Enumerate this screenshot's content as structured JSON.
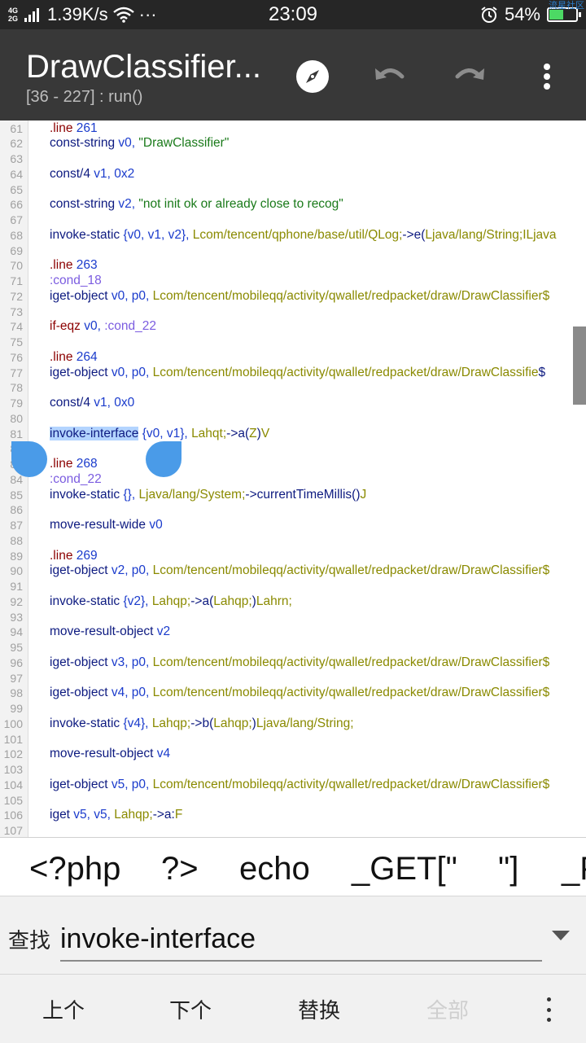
{
  "status_bar": {
    "network_top": "4G",
    "network_bottom": "2G",
    "speed": "1.39K/s",
    "more": "···",
    "time": "23:09",
    "battery_percent": "54%",
    "battery_level": 0.54,
    "watermark": "流星社区"
  },
  "app_bar": {
    "title": "DrawClassifier...",
    "subtitle": "[36 - 227] : run()",
    "icons": [
      "compass-icon",
      "undo-icon",
      "redo-icon",
      "more-vert-icon"
    ]
  },
  "editor": {
    "highlight_text": "invoke-interface",
    "lines": [
      {
        "n": "61",
        "tokens": [
          {
            "t": ".line",
            "c": "dir"
          },
          {
            "t": " 261",
            "c": "num"
          }
        ]
      },
      {
        "n": "62",
        "tokens": [
          {
            "t": "const-string",
            "c": "kw"
          },
          {
            "t": " v0, ",
            "c": "reg"
          },
          {
            "t": "\"DrawClassifier\"",
            "c": "str"
          }
        ]
      },
      {
        "n": "63",
        "tokens": []
      },
      {
        "n": "64",
        "tokens": [
          {
            "t": "const/4",
            "c": "kw"
          },
          {
            "t": " v1, ",
            "c": "reg"
          },
          {
            "t": "0x2",
            "c": "num"
          }
        ]
      },
      {
        "n": "65",
        "tokens": []
      },
      {
        "n": "66",
        "tokens": [
          {
            "t": "const-string",
            "c": "kw"
          },
          {
            "t": " v2, ",
            "c": "reg"
          },
          {
            "t": "\"not init ok or already close to recog\"",
            "c": "str"
          }
        ]
      },
      {
        "n": "67",
        "tokens": []
      },
      {
        "n": "68",
        "tokens": [
          {
            "t": "invoke-static",
            "c": "kw"
          },
          {
            "t": " {v0, v1, v2}, ",
            "c": "reg"
          },
          {
            "t": "Lcom/tencent/qphone/base/util/QLog;",
            "c": "cls"
          },
          {
            "t": "->e(",
            "c": "kw"
          },
          {
            "t": "Ljava/lang/String;ILjava",
            "c": "cls"
          }
        ]
      },
      {
        "n": "69",
        "tokens": []
      },
      {
        "n": "70",
        "tokens": [
          {
            "t": ".line",
            "c": "dir"
          },
          {
            "t": " 263",
            "c": "num"
          }
        ]
      },
      {
        "n": "71",
        "tokens": [
          {
            "t": ":cond_18",
            "c": "lbl"
          }
        ]
      },
      {
        "n": "72",
        "tokens": [
          {
            "t": "iget-object",
            "c": "kw"
          },
          {
            "t": " v0, p0, ",
            "c": "reg"
          },
          {
            "t": "Lcom/tencent/mobileqq/activity/qwallet/redpacket/draw/DrawClassifier$",
            "c": "cls"
          }
        ]
      },
      {
        "n": "73",
        "tokens": []
      },
      {
        "n": "74",
        "tokens": [
          {
            "t": "if-eqz",
            "c": "dir"
          },
          {
            "t": " v0, ",
            "c": "reg"
          },
          {
            "t": ":cond_22",
            "c": "lbl"
          }
        ]
      },
      {
        "n": "75",
        "tokens": []
      },
      {
        "n": "76",
        "tokens": [
          {
            "t": ".line",
            "c": "dir"
          },
          {
            "t": " 264",
            "c": "num"
          }
        ]
      },
      {
        "n": "77",
        "tokens": [
          {
            "t": "iget-object",
            "c": "kw"
          },
          {
            "t": " v0, p0, ",
            "c": "reg"
          },
          {
            "t": "Lcom/tencent/mobileqq/activity/qwallet/redpacket/draw/DrawClassifie",
            "c": "cls"
          },
          {
            "t": "$",
            "c": "kw"
          }
        ]
      },
      {
        "n": "78",
        "tokens": []
      },
      {
        "n": "79",
        "tokens": [
          {
            "t": "const/4",
            "c": "kw"
          },
          {
            "t": " v1, ",
            "c": "reg"
          },
          {
            "t": "0x0",
            "c": "num"
          }
        ]
      },
      {
        "n": "80",
        "tokens": []
      },
      {
        "n": "81",
        "tokens": [
          {
            "t": "invoke-interface",
            "c": "kw hl"
          },
          {
            "t": " {v0, v1}, ",
            "c": "reg"
          },
          {
            "t": "Lahqt;",
            "c": "cls"
          },
          {
            "t": "->a(",
            "c": "kw"
          },
          {
            "t": "Z",
            "c": "cls"
          },
          {
            "t": ")",
            "c": "kw"
          },
          {
            "t": "V",
            "c": "cls"
          }
        ]
      },
      {
        "n": "82",
        "tokens": []
      },
      {
        "n": "83",
        "tokens": [
          {
            "t": ".line",
            "c": "dir"
          },
          {
            "t": " 268",
            "c": "num"
          }
        ]
      },
      {
        "n": "84",
        "tokens": [
          {
            "t": ":cond_22",
            "c": "lbl"
          }
        ]
      },
      {
        "n": "85",
        "tokens": [
          {
            "t": "invoke-static",
            "c": "kw"
          },
          {
            "t": " {}, ",
            "c": "reg"
          },
          {
            "t": "Ljava/lang/System;",
            "c": "cls"
          },
          {
            "t": "->currentTimeMillis()",
            "c": "kw"
          },
          {
            "t": "J",
            "c": "cls"
          }
        ]
      },
      {
        "n": "86",
        "tokens": []
      },
      {
        "n": "87",
        "tokens": [
          {
            "t": "move-result-wide",
            "c": "kw"
          },
          {
            "t": " v0",
            "c": "reg"
          }
        ]
      },
      {
        "n": "88",
        "tokens": []
      },
      {
        "n": "89",
        "tokens": [
          {
            "t": ".line",
            "c": "dir"
          },
          {
            "t": " 269",
            "c": "num"
          }
        ]
      },
      {
        "n": "90",
        "tokens": [
          {
            "t": "iget-object",
            "c": "kw"
          },
          {
            "t": " v2, p0, ",
            "c": "reg"
          },
          {
            "t": "Lcom/tencent/mobileqq/activity/qwallet/redpacket/draw/DrawClassifier$",
            "c": "cls"
          }
        ]
      },
      {
        "n": "91",
        "tokens": []
      },
      {
        "n": "92",
        "tokens": [
          {
            "t": "invoke-static",
            "c": "kw"
          },
          {
            "t": " {v2}, ",
            "c": "reg"
          },
          {
            "t": "Lahqp;",
            "c": "cls"
          },
          {
            "t": "->a(",
            "c": "kw"
          },
          {
            "t": "Lahqp;",
            "c": "cls"
          },
          {
            "t": ")",
            "c": "kw"
          },
          {
            "t": "Lahrn;",
            "c": "cls"
          }
        ]
      },
      {
        "n": "93",
        "tokens": []
      },
      {
        "n": "94",
        "tokens": [
          {
            "t": "move-result-object",
            "c": "kw"
          },
          {
            "t": " v2",
            "c": "reg"
          }
        ]
      },
      {
        "n": "95",
        "tokens": []
      },
      {
        "n": "96",
        "tokens": [
          {
            "t": "iget-object",
            "c": "kw"
          },
          {
            "t": " v3, p0, ",
            "c": "reg"
          },
          {
            "t": "Lcom/tencent/mobileqq/activity/qwallet/redpacket/draw/DrawClassifier$",
            "c": "cls"
          }
        ]
      },
      {
        "n": "97",
        "tokens": []
      },
      {
        "n": "98",
        "tokens": [
          {
            "t": "iget-object",
            "c": "kw"
          },
          {
            "t": " v4, p0, ",
            "c": "reg"
          },
          {
            "t": "Lcom/tencent/mobileqq/activity/qwallet/redpacket/draw/DrawClassifier$",
            "c": "cls"
          }
        ]
      },
      {
        "n": "99",
        "tokens": []
      },
      {
        "n": "100",
        "tokens": [
          {
            "t": "invoke-static",
            "c": "kw"
          },
          {
            "t": " {v4}, ",
            "c": "reg"
          },
          {
            "t": "Lahqp;",
            "c": "cls"
          },
          {
            "t": "->b(",
            "c": "kw"
          },
          {
            "t": "Lahqp;",
            "c": "cls"
          },
          {
            "t": ")",
            "c": "kw"
          },
          {
            "t": "Ljava/lang/String;",
            "c": "cls"
          }
        ]
      },
      {
        "n": "101",
        "tokens": []
      },
      {
        "n": "102",
        "tokens": [
          {
            "t": "move-result-object",
            "c": "kw"
          },
          {
            "t": " v4",
            "c": "reg"
          }
        ]
      },
      {
        "n": "103",
        "tokens": []
      },
      {
        "n": "104",
        "tokens": [
          {
            "t": "iget-object",
            "c": "kw"
          },
          {
            "t": " v5, p0, ",
            "c": "reg"
          },
          {
            "t": "Lcom/tencent/mobileqq/activity/qwallet/redpacket/draw/DrawClassifier$",
            "c": "cls"
          }
        ]
      },
      {
        "n": "105",
        "tokens": []
      },
      {
        "n": "106",
        "tokens": [
          {
            "t": "iget",
            "c": "kw"
          },
          {
            "t": " v5, v5, ",
            "c": "reg"
          },
          {
            "t": "Lahqp;",
            "c": "cls"
          },
          {
            "t": "->a:",
            "c": "kw"
          },
          {
            "t": "F",
            "c": "cls"
          }
        ]
      },
      {
        "n": "107",
        "tokens": []
      }
    ]
  },
  "symbol_bar": {
    "items": [
      "<?php",
      "?>",
      "echo",
      "_GET[\"",
      "\"]",
      "_P"
    ]
  },
  "find_bar": {
    "label": "查找",
    "value": "invoke-interface"
  },
  "action_bar": {
    "prev": "上个",
    "next": "下个",
    "replace": "替换",
    "all": "全部"
  },
  "colors": {
    "app_bar": "#383838",
    "status_bar": "#262626",
    "selection_handle": "#4a9be8",
    "highlight": "#b3d4ff"
  }
}
